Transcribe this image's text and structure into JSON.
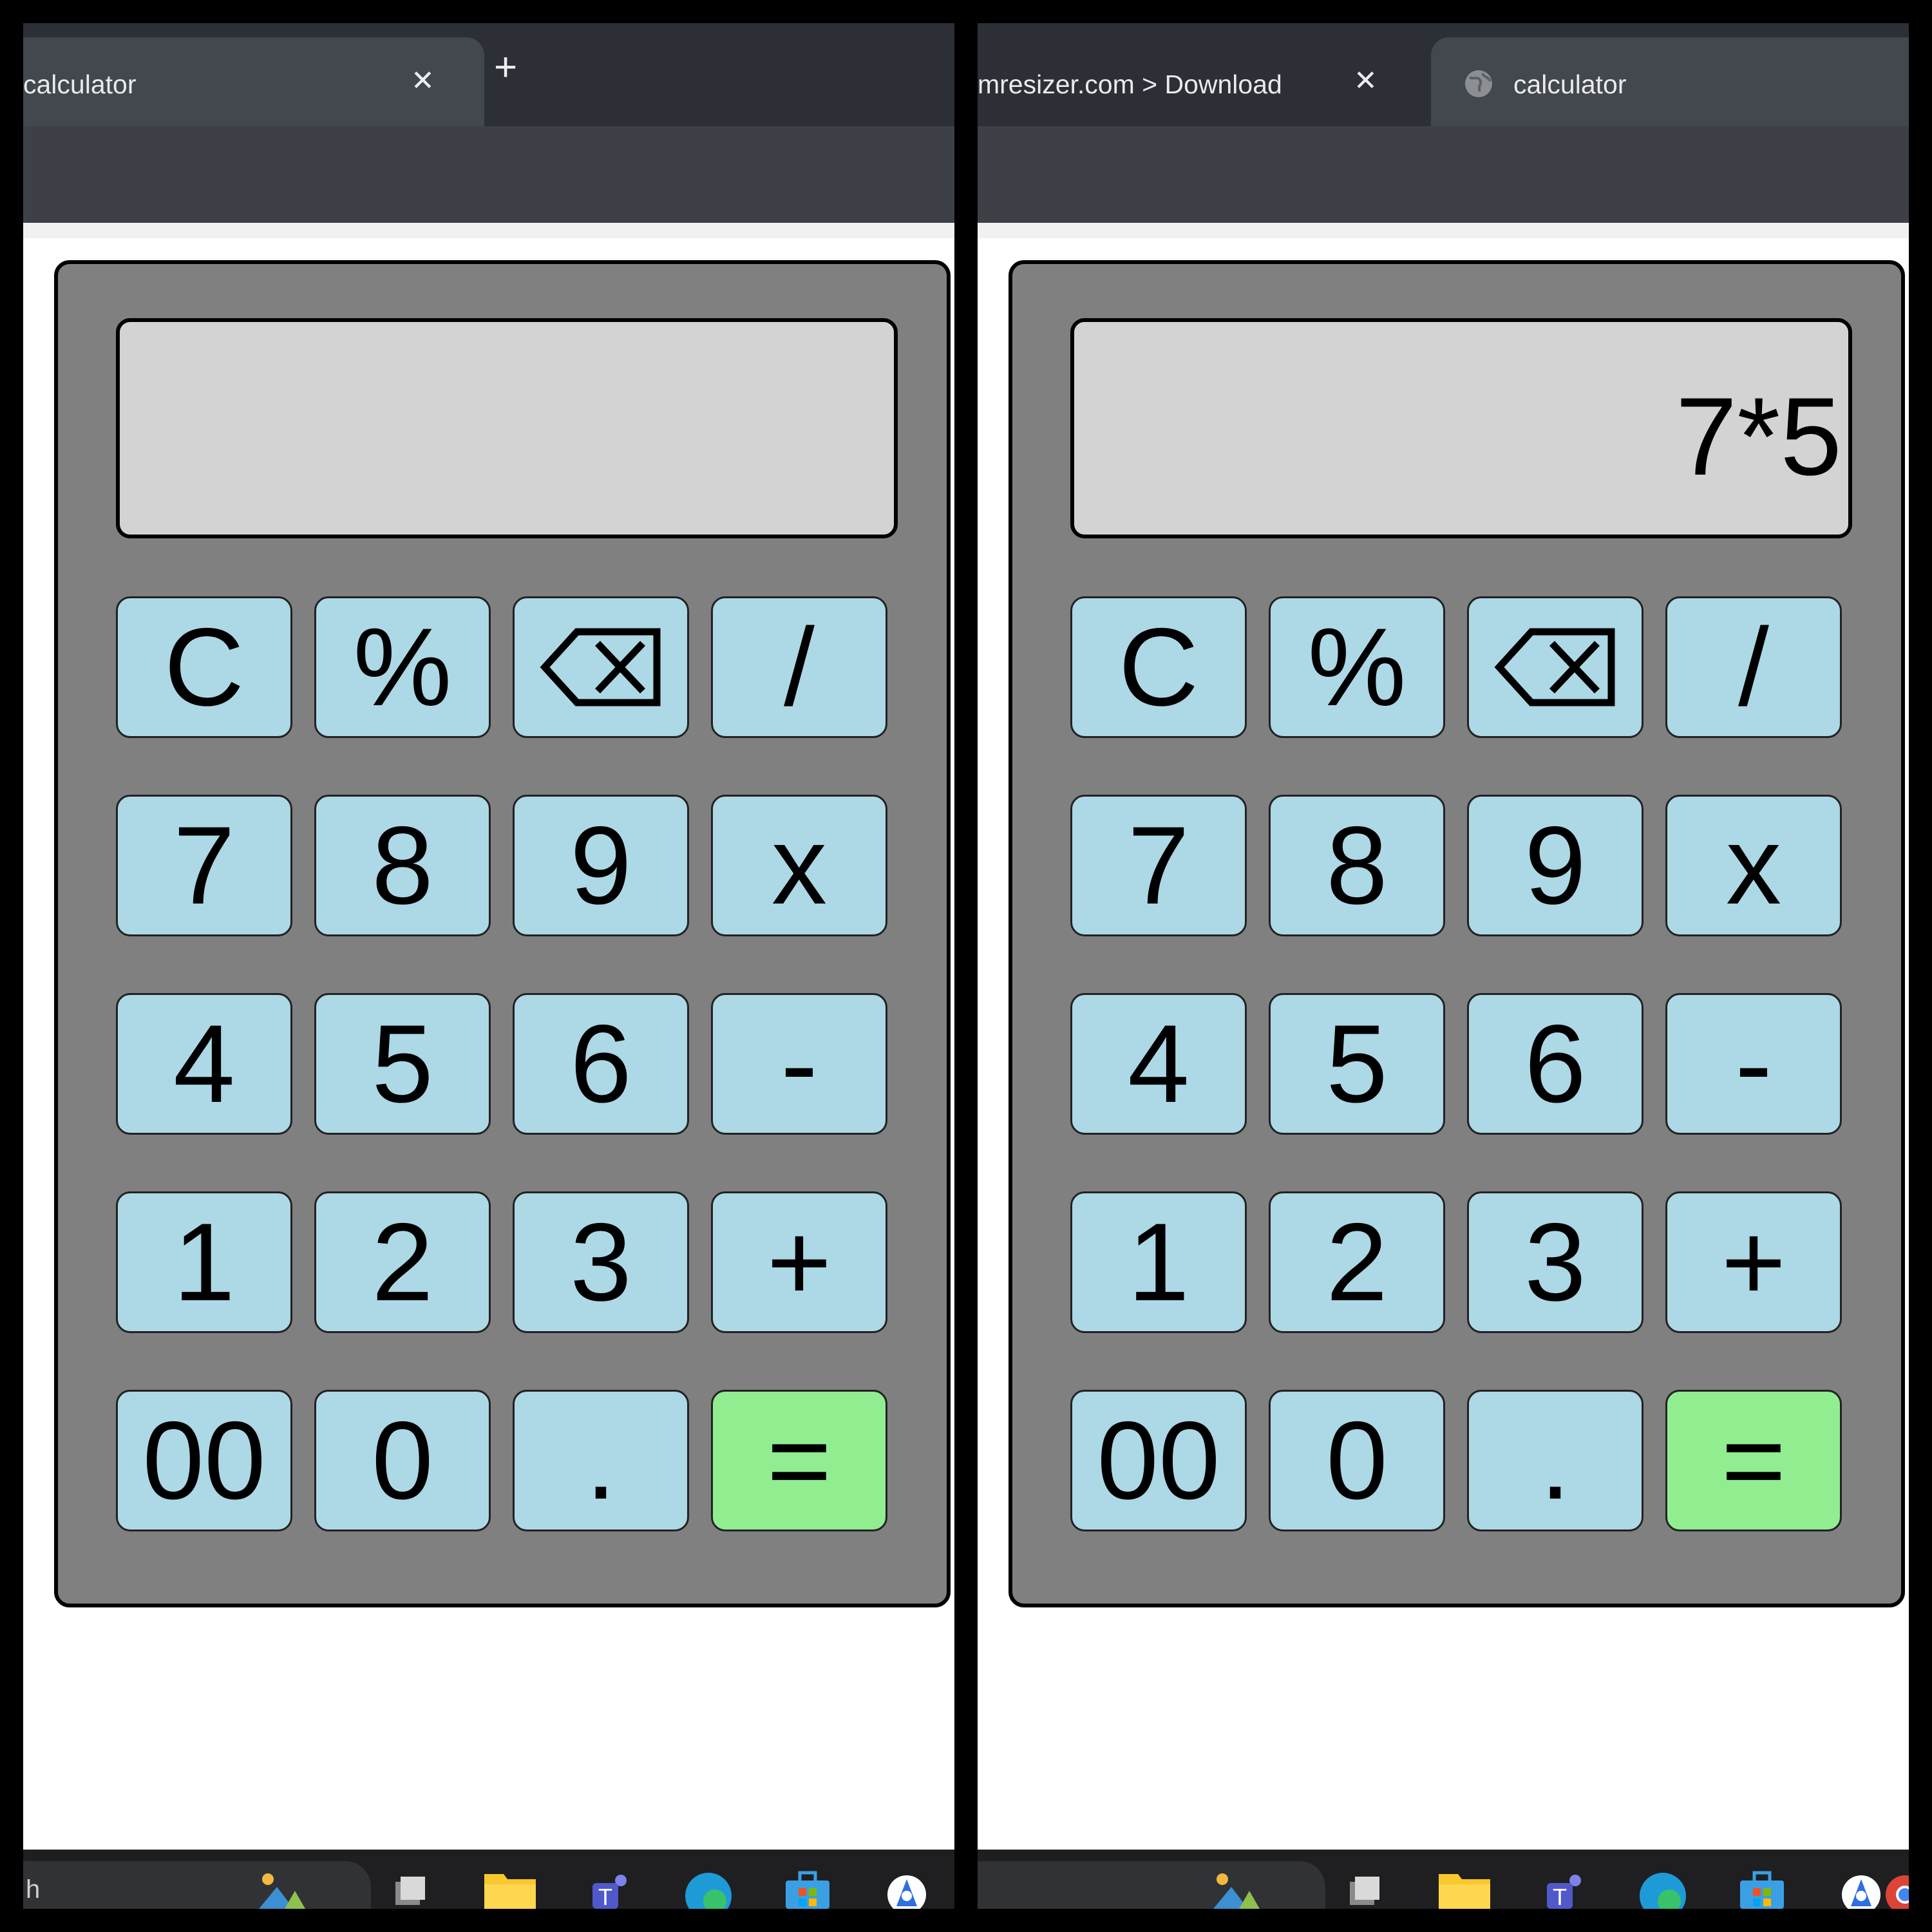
{
  "left_window": {
    "tabs": [
      {
        "title": "calculator",
        "close_glyph": "✕",
        "active": true
      }
    ],
    "new_tab_glyph": "+",
    "display": {
      "value": ""
    },
    "taskbar": {
      "search_text": "h"
    }
  },
  "right_window": {
    "tabs": [
      {
        "title": "mresizer.com > Download",
        "close_glyph": "✕",
        "active": false
      },
      {
        "title": "calculator",
        "icon": "globe-icon",
        "active": true
      }
    ],
    "display": {
      "value": "7*5"
    }
  },
  "keypad": {
    "rows": [
      [
        "C",
        "%",
        "backspace-icon",
        "/"
      ],
      [
        "7",
        "8",
        "9",
        "x"
      ],
      [
        "4",
        "5",
        "6",
        "-"
      ],
      [
        "1",
        "2",
        "3",
        "+"
      ],
      [
        "00",
        "0",
        ".",
        "="
      ]
    ]
  },
  "colors": {
    "calculator_body": "#808080",
    "display_background": "#d3d3d3",
    "key": "#add8e6",
    "equals_key": "#90ee90",
    "tabstrip": "#2c2f35",
    "active_tab": "#43474e",
    "toolbar": "#3d4047"
  },
  "taskbar_icons": [
    "widgets-icon",
    "task-view-icon",
    "file-explorer-icon",
    "teams-icon",
    "edge-icon",
    "microsoft-store-icon",
    "app-icon",
    "chrome-icon"
  ]
}
